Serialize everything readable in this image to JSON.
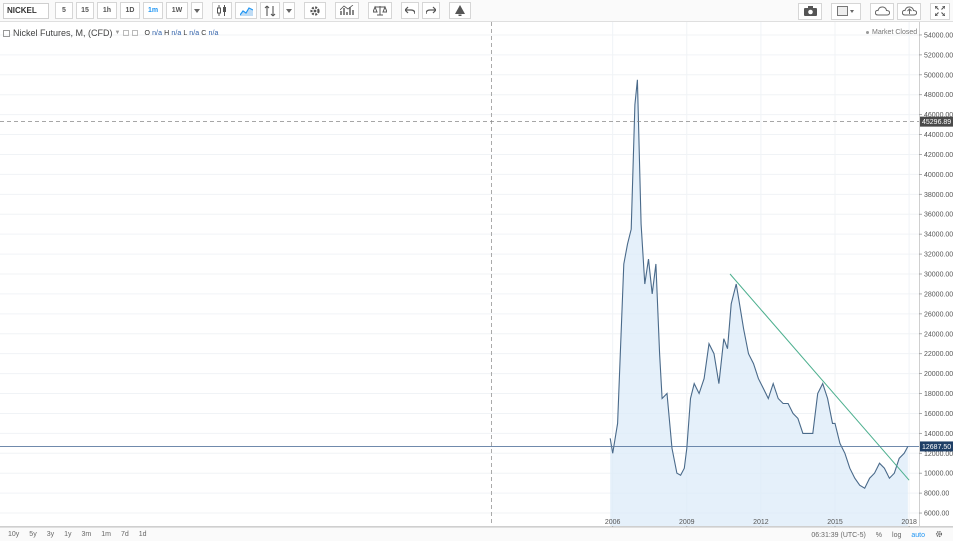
{
  "toolbar": {
    "symbol": "NICKEL",
    "intervals": [
      "5",
      "15",
      "1h",
      "1D",
      "1m",
      "1W"
    ],
    "active_interval": "1m"
  },
  "legend": {
    "title": "Nickel Futures, M, (CFD)",
    "ohlc": {
      "o_label": "O",
      "o": "n/a",
      "h_label": "H",
      "h": "n/a",
      "l_label": "L",
      "l": "n/a",
      "c_label": "C",
      "c": "n/a"
    }
  },
  "market_status": "Market Closed",
  "bottombar": {
    "ranges": [
      "10y",
      "5y",
      "3y",
      "1y",
      "3m",
      "1m",
      "7d",
      "1d"
    ],
    "clock": "06:31:39 (UTC-5)",
    "percent_label": "%",
    "log_label": "log",
    "auto_label": "auto"
  },
  "colors": {
    "line": "#4a6a8a",
    "area_fill": "#dcebf8",
    "trendline": "#4caf8e",
    "last_price_bg": "#1f3f66",
    "crosshair_bg": "#4a4a4a"
  },
  "chart_data": {
    "type": "area",
    "series": [
      {
        "x": [
          2005.9,
          2006.0,
          2006.2,
          2006.45,
          2006.6,
          2006.75,
          2006.9,
          2007.0,
          2007.15,
          2007.3,
          2007.45,
          2007.6,
          2007.75,
          2007.9,
          2008.0,
          2008.2,
          2008.4,
          2008.6,
          2008.75,
          2008.9,
          2009.0,
          2009.15,
          2009.3,
          2009.5,
          2009.7,
          2009.9,
          2010.1,
          2010.3,
          2010.5,
          2010.65,
          2010.8,
          2011.0,
          2011.1,
          2011.3,
          2011.5,
          2011.7,
          2011.9,
          2012.1,
          2012.3,
          2012.5,
          2012.7,
          2012.9,
          2013.1,
          2013.3,
          2013.5,
          2013.7,
          2013.9,
          2014.1,
          2014.3,
          2014.5,
          2014.7,
          2014.9,
          2015.0,
          2015.2,
          2015.4,
          2015.6,
          2015.8,
          2016.0,
          2016.2,
          2016.4,
          2016.6,
          2016.8,
          2017.0,
          2017.2,
          2017.4,
          2017.6,
          2017.8,
          2017.95
        ],
        "values": [
          13500,
          12000,
          15000,
          31000,
          33000,
          34500,
          47000,
          49500,
          35000,
          29000,
          31500,
          28000,
          31000,
          22000,
          17500,
          18000,
          12500,
          10000,
          9800,
          10500,
          12500,
          17500,
          19000,
          18000,
          19500,
          23000,
          22000,
          19000,
          23500,
          22500,
          27000,
          29000,
          27500,
          24500,
          22000,
          21000,
          19500,
          18500,
          17500,
          19000,
          17500,
          17000,
          17000,
          16000,
          15500,
          14000,
          14000,
          14000,
          18000,
          19000,
          17500,
          15000,
          15000,
          13000,
          12000,
          10500,
          9500,
          8800,
          8500,
          9500,
          10000,
          11000,
          10500,
          9500,
          10000,
          11500,
          12000,
          12688
        ]
      }
    ],
    "trendline": {
      "x": [
        2010.75,
        2018.0
      ],
      "y": [
        30000,
        9300
      ]
    },
    "last_price": 12687.5,
    "last_price_label": "12687.50",
    "crosshair": {
      "x": 2001.1,
      "y": 45296.89,
      "label": "45296.89"
    },
    "x_ticks": [
      2006,
      2009,
      2012,
      2015,
      2018
    ],
    "x_tick_labels": [
      "2006",
      "2009",
      "2012",
      "2015",
      "2018"
    ],
    "y_ticks": [
      6000,
      8000,
      10000,
      12000,
      14000,
      16000,
      18000,
      20000,
      22000,
      24000,
      26000,
      28000,
      30000,
      32000,
      34000,
      36000,
      38000,
      40000,
      42000,
      44000,
      46000,
      48000,
      50000,
      52000,
      54000
    ],
    "y_tick_labels": [
      "6000.00",
      "8000.00",
      "10000.00",
      "12000.00",
      "14000.00",
      "16000.00",
      "18000.00",
      "20000.00",
      "22000.00",
      "24000.00",
      "26000.00",
      "28000.00",
      "30000.00",
      "32000.00",
      "34000.00",
      "36000.00",
      "38000.00",
      "40000.00",
      "42000.00",
      "44000.00",
      "46000.00",
      "48000.00",
      "50000.00",
      "52000.00",
      "54000.00"
    ],
    "xlim": [
      1981.2,
      2018.4
    ],
    "ylim": [
      4700,
      55300
    ],
    "grid": true,
    "xlabel": "",
    "ylabel": "",
    "title": "Nickel Futures, M, (CFD)"
  }
}
